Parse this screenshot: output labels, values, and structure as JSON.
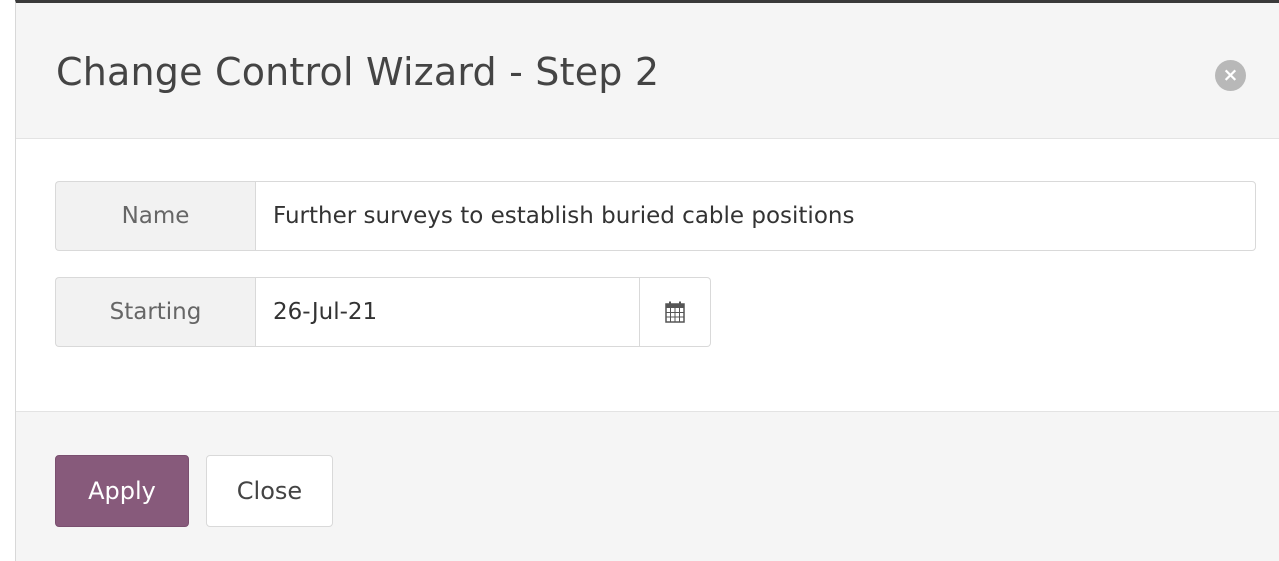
{
  "dialog": {
    "title": "Change Control Wizard - Step 2",
    "close_glyph": "×"
  },
  "form": {
    "name": {
      "label": "Name",
      "value": "Further surveys to establish buried cable positions"
    },
    "starting": {
      "label": "Starting",
      "value": "26-Jul-21",
      "icon": "calendar-icon"
    }
  },
  "footer": {
    "apply_label": "Apply",
    "close_label": "Close"
  },
  "colors": {
    "primary": "#875a7b",
    "header_bg": "#f5f5f5",
    "addon_bg": "#f2f2f2",
    "close_icon_bg": "#b8b8b8"
  }
}
